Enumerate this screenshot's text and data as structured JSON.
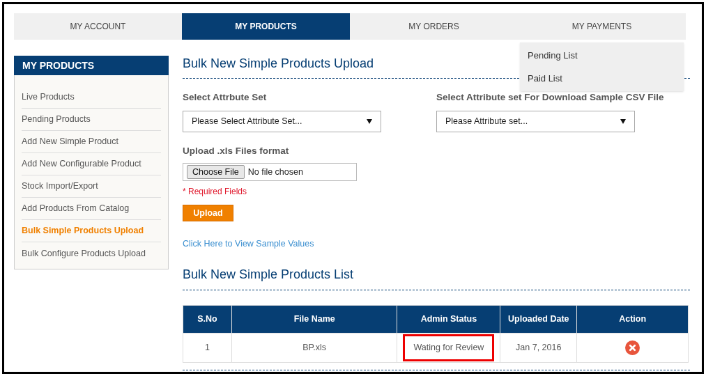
{
  "nav_tabs": [
    {
      "label": "MY ACCOUNT",
      "selected": false
    },
    {
      "label": "MY PRODUCTS",
      "selected": true
    },
    {
      "label": "MY ORDERS",
      "selected": false
    },
    {
      "label": "MY PAYMENTS",
      "selected": false,
      "menu": [
        "Pending List",
        "Paid List"
      ]
    }
  ],
  "sidebar": {
    "title": "MY PRODUCTS",
    "items": [
      {
        "label": "Live Products",
        "selected": false
      },
      {
        "label": "Pending Products",
        "selected": false
      },
      {
        "label": "Add New Simple Product",
        "selected": false
      },
      {
        "label": "Add New Configurable Product",
        "selected": false
      },
      {
        "label": "Stock Import/Export",
        "selected": false
      },
      {
        "label": "Add Products From Catalog",
        "selected": false
      },
      {
        "label": "Bulk Simple Products Upload",
        "selected": true
      },
      {
        "label": "Bulk Configure Products Upload",
        "selected": false
      }
    ]
  },
  "upload_section": {
    "title": "Bulk New Simple Products Upload",
    "attribute_set": {
      "label": "Select Attrbute Set",
      "value": "Please Select Attribute Set..."
    },
    "sample_attribute_set": {
      "label": "Select Attribute set For Download Sample CSV File",
      "value": "Please Attribute set..."
    },
    "file_upload": {
      "label": "Upload .xls Files format",
      "button": "Choose File",
      "value": "No file chosen"
    },
    "required_note": "* Required Fields",
    "upload_button": "Upload",
    "sample_link": "Click Here to View Sample Values"
  },
  "list_section": {
    "title": "Bulk New Simple Products List",
    "table": {
      "columns": [
        "S.No",
        "File Name",
        "Admin Status",
        "Uploaded Date",
        "Action"
      ],
      "rows": [
        {
          "number": "1",
          "file_name": "BP.xls",
          "admin_status": "Wating for Review",
          "status_highlighted": true,
          "uploaded_date": "Jan 7, 2016"
        }
      ]
    }
  }
}
